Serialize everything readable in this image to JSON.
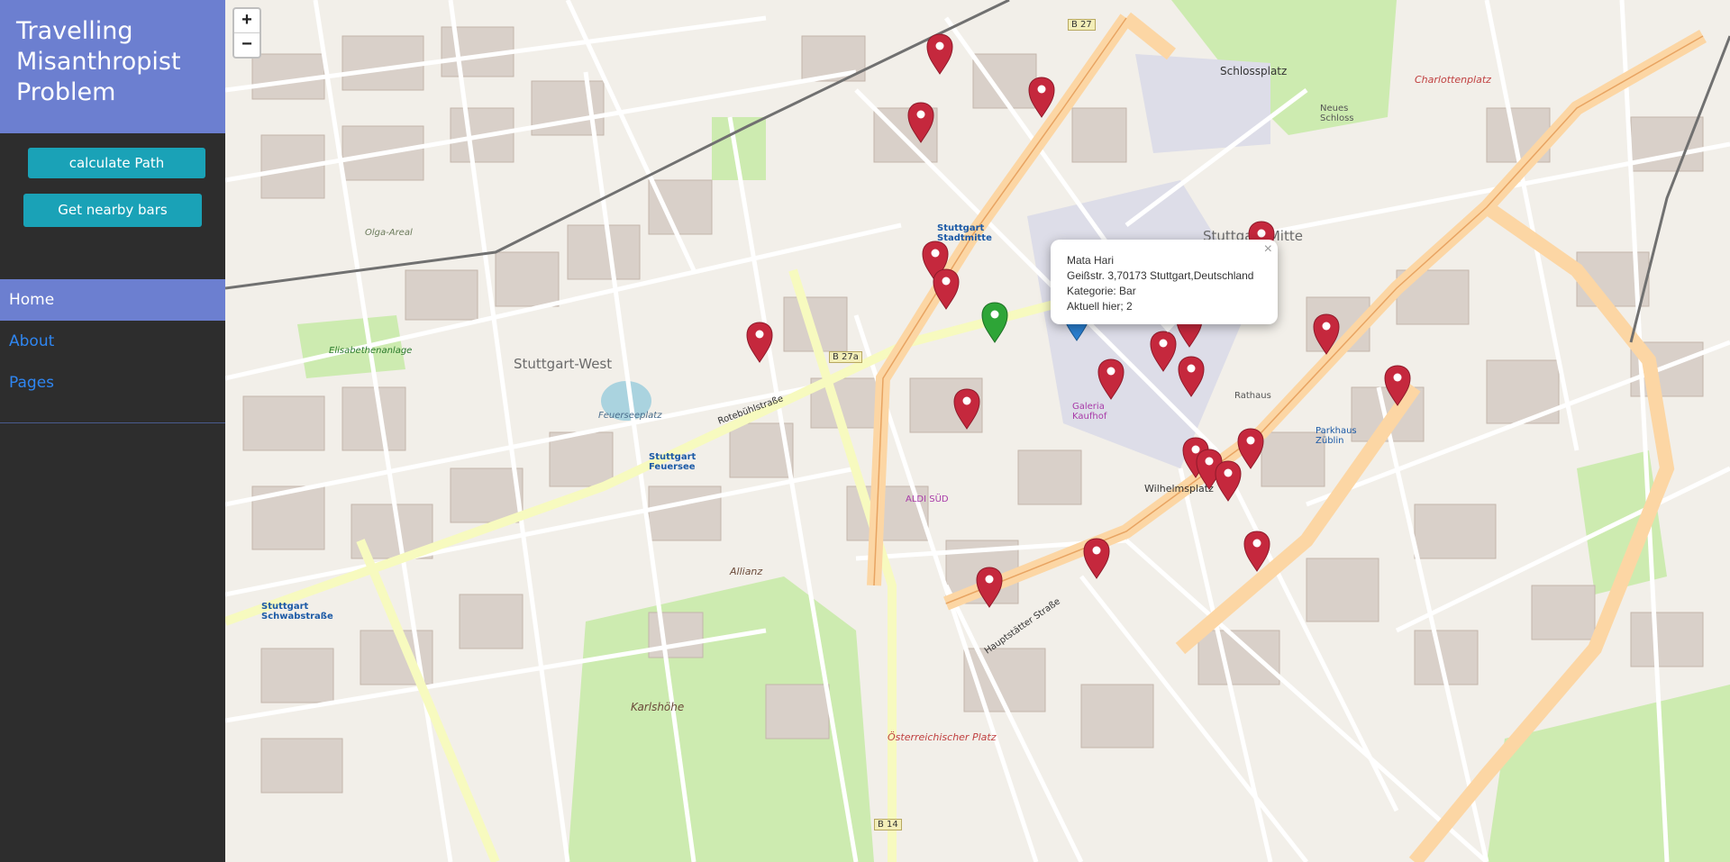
{
  "app": {
    "title_lines": [
      "Travelling",
      "Misanthropist",
      "Problem"
    ]
  },
  "buttons": {
    "calculate": "calculate Path",
    "nearby": "Get nearby bars"
  },
  "nav": {
    "items": [
      {
        "label": "Home",
        "active": true
      },
      {
        "label": "About",
        "active": false
      },
      {
        "label": "Pages",
        "active": false
      }
    ]
  },
  "map": {
    "zoom_in": "+",
    "zoom_out": "−",
    "popup": {
      "close": "×",
      "name": "Mata Hari",
      "address": "Geißstr. 3,70173 Stuttgart,Deutschland",
      "category": "Kategorie: Bar",
      "current": "Aktuell hier; 2"
    },
    "labels": {
      "stuttgart_west": "Stuttgart-West",
      "stuttgart_mitte": "Stuttgart-Mitte",
      "schlossplatz": "Schlossplatz",
      "wilhelmsplatz": "Wilhelmsplatz",
      "karlshoehe": "Karlshöhe",
      "feuerseeplatz": "Feuerseeplatz",
      "oesterreichischer_platz": "Österreichischer Platz",
      "charlottenplatz": "Charlottenplatz",
      "rotebuehlstrasse": "Rotebühlstraße",
      "hauptstaetter_strasse": "Hauptstätter Straße",
      "b27a": "B 27a",
      "b27": "B 27",
      "b14": "B 14",
      "olga_areal": "Olga-Areal",
      "elisabethenanlage": "Elisabethenanlage",
      "allianz": "Allianz",
      "stadtmitte": "Stuttgart Stadtmitte",
      "feuersee": "Stuttgart Feuersee",
      "schwabstrasse": "Stuttgart Schwabstraße",
      "rathaus": "Rathaus",
      "neues_schloss": "Neues Schloss",
      "aldi": "ALDI SÜD",
      "galeria": "Galeria Kaufhof",
      "parkhaus": "Parkhaus Züblin"
    }
  }
}
